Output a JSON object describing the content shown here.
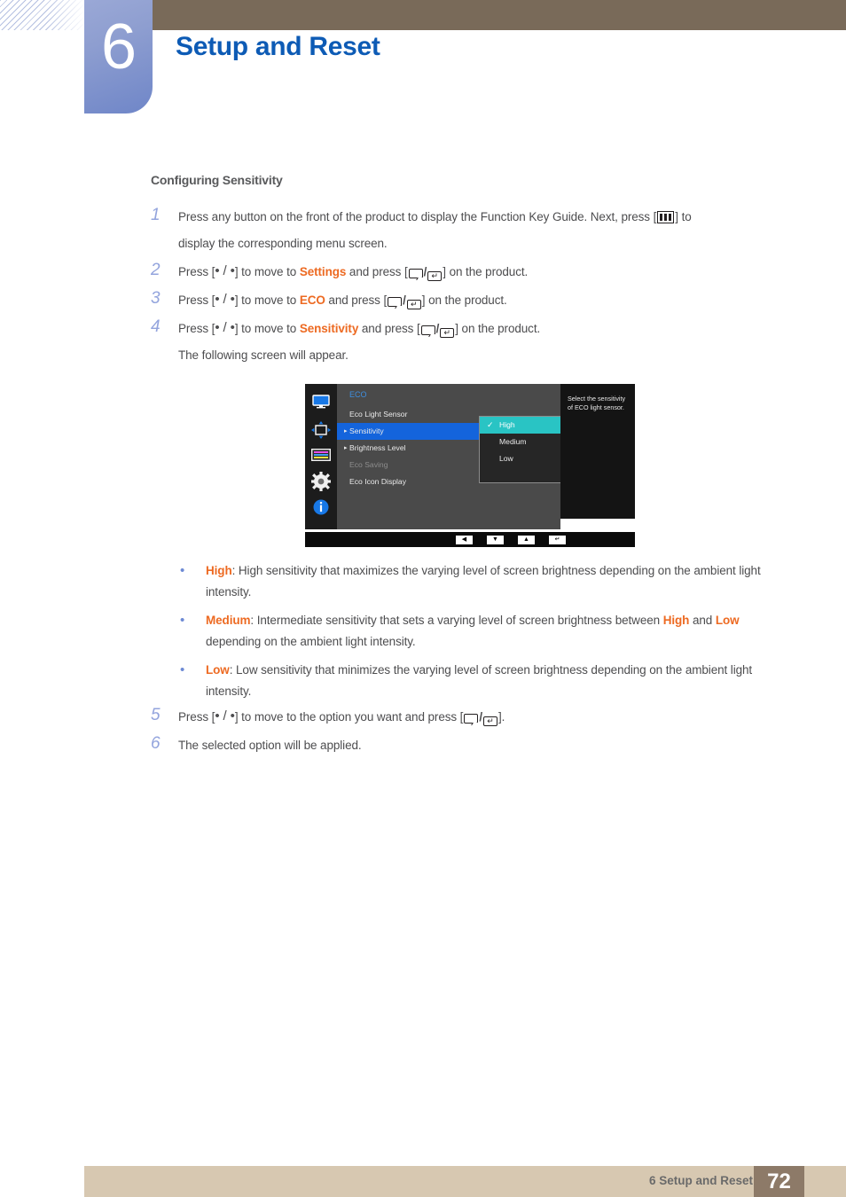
{
  "header": {
    "chapter_number": "6",
    "chapter_title": "Setup and Reset"
  },
  "section": {
    "heading": "Configuring Sensitivity"
  },
  "steps": [
    {
      "number": "1",
      "text_before": "Press any button on the front of the product to display the Function Key Guide. Next, press [",
      "text_after": "] to",
      "sub": "display the corresponding menu screen."
    },
    {
      "number": "2",
      "p1": "Press [",
      "keys": "• / •",
      "p2": "] to move to ",
      "target": "Settings",
      "p3": " and press [",
      "p4": "] on the product."
    },
    {
      "number": "3",
      "p1": "Press [",
      "keys": "• / •",
      "p2": "] to move to ",
      "target": "ECO",
      "p3": " and press [",
      "p4": "] on the product."
    },
    {
      "number": "4",
      "p1": "Press [",
      "keys": "• / •",
      "p2": "] to move to ",
      "target": "Sensitivity",
      "p3": " and press [",
      "p4": "] on the product.",
      "sub": "The following screen will appear."
    }
  ],
  "steps_after": [
    {
      "number": "5",
      "p1": "Press [",
      "keys": "• / •",
      "p2": "] to move to the option you want and press [",
      "p3": "]."
    },
    {
      "number": "6",
      "p1": "The selected option will be applied."
    }
  ],
  "osd": {
    "title": "ECO",
    "help_text": "Select the sensitivity of ECO light sensor.",
    "icons": [
      {
        "name": "monitor-icon"
      },
      {
        "name": "move-arrows-icon"
      },
      {
        "name": "color-bars-icon"
      },
      {
        "name": "gear-icon"
      },
      {
        "name": "info-icon"
      }
    ],
    "menu_items": [
      {
        "label": "Eco Light Sensor",
        "arrow": false,
        "selected": false,
        "dim": false
      },
      {
        "label": "Sensitivity",
        "arrow": true,
        "selected": true,
        "dim": false
      },
      {
        "label": "Brightness Level",
        "arrow": true,
        "selected": false,
        "dim": false
      },
      {
        "label": "Eco Saving",
        "arrow": false,
        "selected": false,
        "dim": true
      },
      {
        "label": "Eco Icon Display",
        "arrow": false,
        "selected": false,
        "dim": false
      }
    ],
    "dropdown": [
      {
        "label": "High",
        "checked": true
      },
      {
        "label": "Medium",
        "checked": false
      },
      {
        "label": "Low",
        "checked": false
      }
    ],
    "nav_buttons": [
      "◀",
      "▼",
      "▲",
      "↵"
    ]
  },
  "bullets": [
    {
      "term": "High",
      "text": ": High sensitivity that maximizes the varying level of screen brightness depending on the ambient light intensity."
    },
    {
      "term": "Medium",
      "t1": ": Intermediate sensitivity that sets a varying level of screen brightness between ",
      "term2": "High",
      "t2": " and ",
      "term3": "Low",
      "t3": " depending on the ambient light intensity."
    },
    {
      "term": "Low",
      "text": ": Low sensitivity that minimizes the varying level of screen brightness depending on the ambient light intensity."
    }
  ],
  "footer": {
    "label": "6 Setup and Reset",
    "page": "72"
  },
  "colors": {
    "accent_orange": "#ed6a22",
    "title_blue": "#0d5bb5",
    "header_brown": "#796a59",
    "footer_tan": "#d7c8b1",
    "page_box": "#8d7a68",
    "osd_select_blue": "#1464dc",
    "osd_highlight_teal": "#29c4c4"
  }
}
